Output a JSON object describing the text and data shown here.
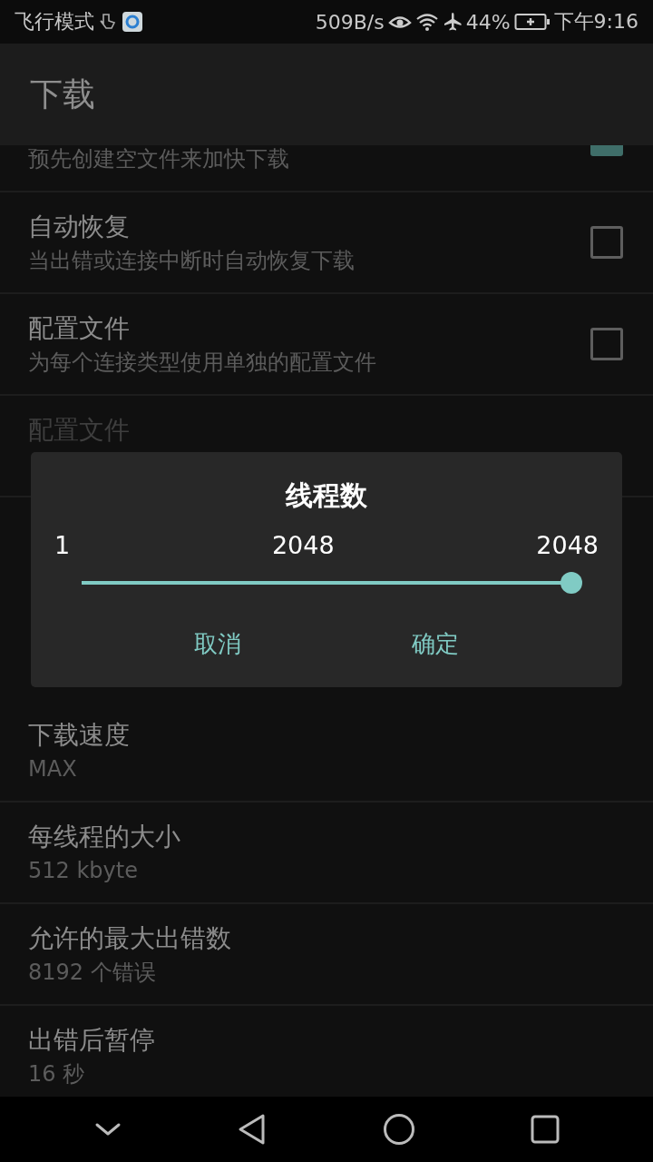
{
  "status_bar": {
    "carrier": "飞行模式",
    "speed": "509B/s",
    "battery": "44%",
    "time": "下午9:16"
  },
  "app_bar": {
    "title": "下载"
  },
  "settings_above": [
    {
      "kind": "checkbox",
      "subtitle": "预先创建空文件来加快下载",
      "checked": true,
      "disabled": false
    },
    {
      "kind": "checkbox",
      "title": "自动恢复",
      "subtitle": "当出错或连接中断时自动恢复下载",
      "checked": false,
      "disabled": false
    },
    {
      "kind": "checkbox",
      "title": "配置文件",
      "subtitle": "为每个连接类型使用单独的配置文件",
      "checked": false,
      "disabled": false
    },
    {
      "kind": "text",
      "title": "配置文件",
      "disabled": true
    }
  ],
  "settings_below": [
    {
      "kind": "text",
      "title": "下载速度",
      "subtitle": "MAX",
      "disabled": false
    },
    {
      "kind": "text",
      "title": "每线程的大小",
      "subtitle": "512 kbyte",
      "disabled": false
    },
    {
      "kind": "text",
      "title": "允许的最大出错数",
      "subtitle": "8192 个错误",
      "disabled": false
    },
    {
      "kind": "text",
      "title": "出错后暂停",
      "subtitle": "16 秒",
      "disabled": false
    }
  ],
  "dialog": {
    "title": "线程数",
    "min_label": "1",
    "value_label": "2048",
    "max_label": "2048",
    "level": 1,
    "buttons": [
      "取消",
      "确定"
    ]
  }
}
